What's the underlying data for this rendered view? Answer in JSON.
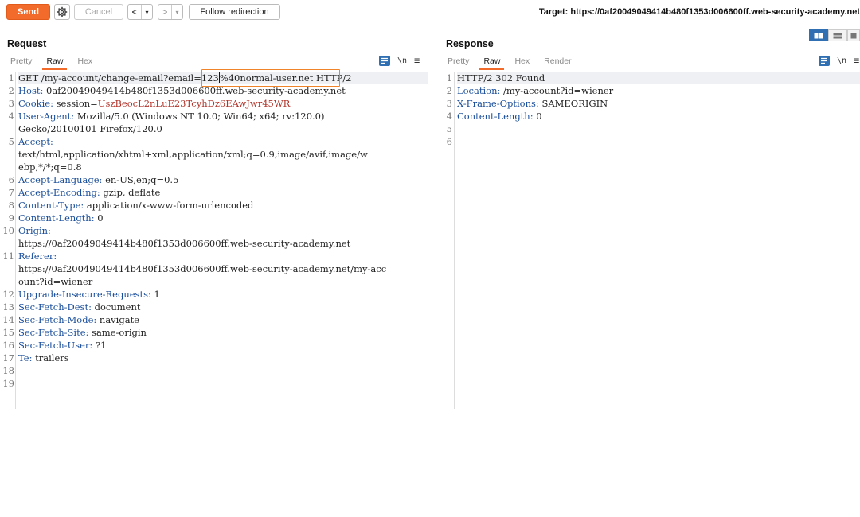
{
  "toolbar": {
    "send_label": "Send",
    "cancel_label": "Cancel",
    "back_glyph": "<",
    "forward_glyph": ">",
    "dropdown_glyph": "▾",
    "follow_label": "Follow redirection",
    "target_text": "Target: https://0af20049049414b480f1353d006600ff.web-security-academy.net"
  },
  "request": {
    "title": "Request",
    "tabs": [
      "Pretty",
      "Raw",
      "Hex"
    ],
    "active_tab": "Raw",
    "newline_label": "\\n",
    "menu_glyph": "≡",
    "line_numbers": [
      "1",
      "2",
      "3",
      "4",
      "",
      "5",
      "",
      "",
      "6",
      "7",
      "8",
      "9",
      "10",
      "",
      "11",
      "",
      "",
      "12",
      "13",
      "14",
      "15",
      "16",
      "17",
      "18",
      "19"
    ],
    "line1": {
      "before_highlight": "GET /my-account/change-email?ema",
      "highlight_a": "il=123",
      "highlight_b": "%40normal-user.net",
      "after": " HTTP/2"
    },
    "host": {
      "key": "Host:",
      "value": " 0af20049049414b480f1353d006600ff.web-security-academy.net"
    },
    "cookie": {
      "key": "Cookie:",
      "name": " session=",
      "value": "UszBeocL2nLuE23TcyhDz6EAwJwr45WR"
    },
    "user_agent": {
      "key": "User-Agent:",
      "value1": " Mozilla/5.0 (Windows NT 10.0; Win64; x64; rv:120.0)",
      "value2": "Gecko/20100101 Firefox/120.0"
    },
    "accept": {
      "key": "Accept:",
      "value1": "text/html,application/xhtml+xml,application/xml;q=0.9,image/avif,image/w",
      "value2": "ebp,*/*;q=0.8"
    },
    "accept_language": {
      "key": "Accept-Language:",
      "value": " en-US,en;q=0.5"
    },
    "accept_encoding": {
      "key": "Accept-Encoding:",
      "value": " gzip, deflate"
    },
    "content_type": {
      "key": "Content-Type:",
      "value": " application/x-www-form-urlencoded"
    },
    "content_length": {
      "key": "Content-Length:",
      "value": " 0"
    },
    "origin": {
      "key": "Origin:",
      "value": "https://0af20049049414b480f1353d006600ff.web-security-academy.net"
    },
    "referer": {
      "key": "Referer:",
      "value1": "https://0af20049049414b480f1353d006600ff.web-security-academy.net/my-acc",
      "value2": "ount?id=wiener"
    },
    "upgrade": {
      "key": "Upgrade-Insecure-Requests:",
      "value": " 1"
    },
    "sec_dest": {
      "key": "Sec-Fetch-Dest:",
      "value": " document"
    },
    "sec_mode": {
      "key": "Sec-Fetch-Mode:",
      "value": " navigate"
    },
    "sec_site": {
      "key": "Sec-Fetch-Site:",
      "value": " same-origin"
    },
    "sec_user": {
      "key": "Sec-Fetch-User:",
      "value": " ?1"
    },
    "te": {
      "key": "Te:",
      "value": " trailers"
    }
  },
  "response": {
    "title": "Response",
    "tabs": [
      "Pretty",
      "Raw",
      "Hex",
      "Render"
    ],
    "active_tab": "Raw",
    "newline_label": "\\n",
    "menu_glyph": "≡",
    "line_numbers": [
      "1",
      "2",
      "3",
      "4",
      "5",
      "6"
    ],
    "status_line": "HTTP/2 302 Found",
    "location": {
      "key": "Location:",
      "value": " /my-account?id=wiener"
    },
    "xframe": {
      "key": "X-Frame-Options:",
      "value": " SAMEORIGIN"
    },
    "content_length": {
      "key": "Content-Length:",
      "value": " 0"
    }
  },
  "colors": {
    "accent": "#f26b2b",
    "header_key": "#1a4e9a",
    "cookie_value": "#b2342a",
    "toggle_blue": "#2f6fb2"
  }
}
